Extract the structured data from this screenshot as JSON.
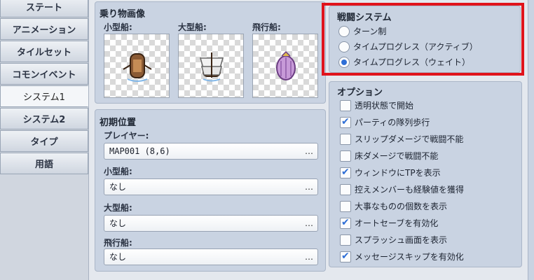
{
  "tabs": [
    {
      "label": "ステート",
      "active": false
    },
    {
      "label": "アニメーション",
      "active": false
    },
    {
      "label": "タイルセット",
      "active": false
    },
    {
      "label": "コモンイベント",
      "active": false
    },
    {
      "label": "システム1",
      "active": true
    },
    {
      "label": "システム2",
      "active": false
    },
    {
      "label": "タイプ",
      "active": false
    },
    {
      "label": "用語",
      "active": false
    }
  ],
  "vehicles": {
    "title": "乗り物画像",
    "boat_label": "小型船:",
    "ship_label": "大型船:",
    "airship_label": "飛行船:"
  },
  "initial_position": {
    "title": "初期位置",
    "player_label": "プレイヤー:",
    "player_value": "MAP001 (8,6)",
    "boat_label": "小型船:",
    "boat_value": "なし",
    "ship_label": "大型船:",
    "ship_value": "なし",
    "airship_label": "飛行船:",
    "airship_value": "なし",
    "more_glyph": "…"
  },
  "battle_system": {
    "title": "戦闘システム",
    "options": [
      {
        "label": "ターン制",
        "selected": false
      },
      {
        "label": "タイムプログレス（アクティブ）",
        "selected": false
      },
      {
        "label": "タイムプログレス（ウェイト）",
        "selected": true
      }
    ]
  },
  "options": {
    "title": "オプション",
    "items": [
      {
        "label": "透明状態で開始",
        "checked": false
      },
      {
        "label": "パーティの隊列歩行",
        "checked": true
      },
      {
        "label": "スリップダメージで戦闘不能",
        "checked": false
      },
      {
        "label": "床ダメージで戦闘不能",
        "checked": false
      },
      {
        "label": "ウィンドウにTPを表示",
        "checked": true
      },
      {
        "label": "控えメンバーも経験値を獲得",
        "checked": false
      },
      {
        "label": "大事なものの個数を表示",
        "checked": false
      },
      {
        "label": "オートセーブを有効化",
        "checked": true
      },
      {
        "label": "スプラッシュ画面を表示",
        "checked": false
      },
      {
        "label": "メッセージスキップを有効化",
        "checked": true
      }
    ]
  },
  "colors": {
    "accent": "#2f6fd6",
    "highlight": "#e0131b",
    "group_bg": "#c9d3e2"
  }
}
